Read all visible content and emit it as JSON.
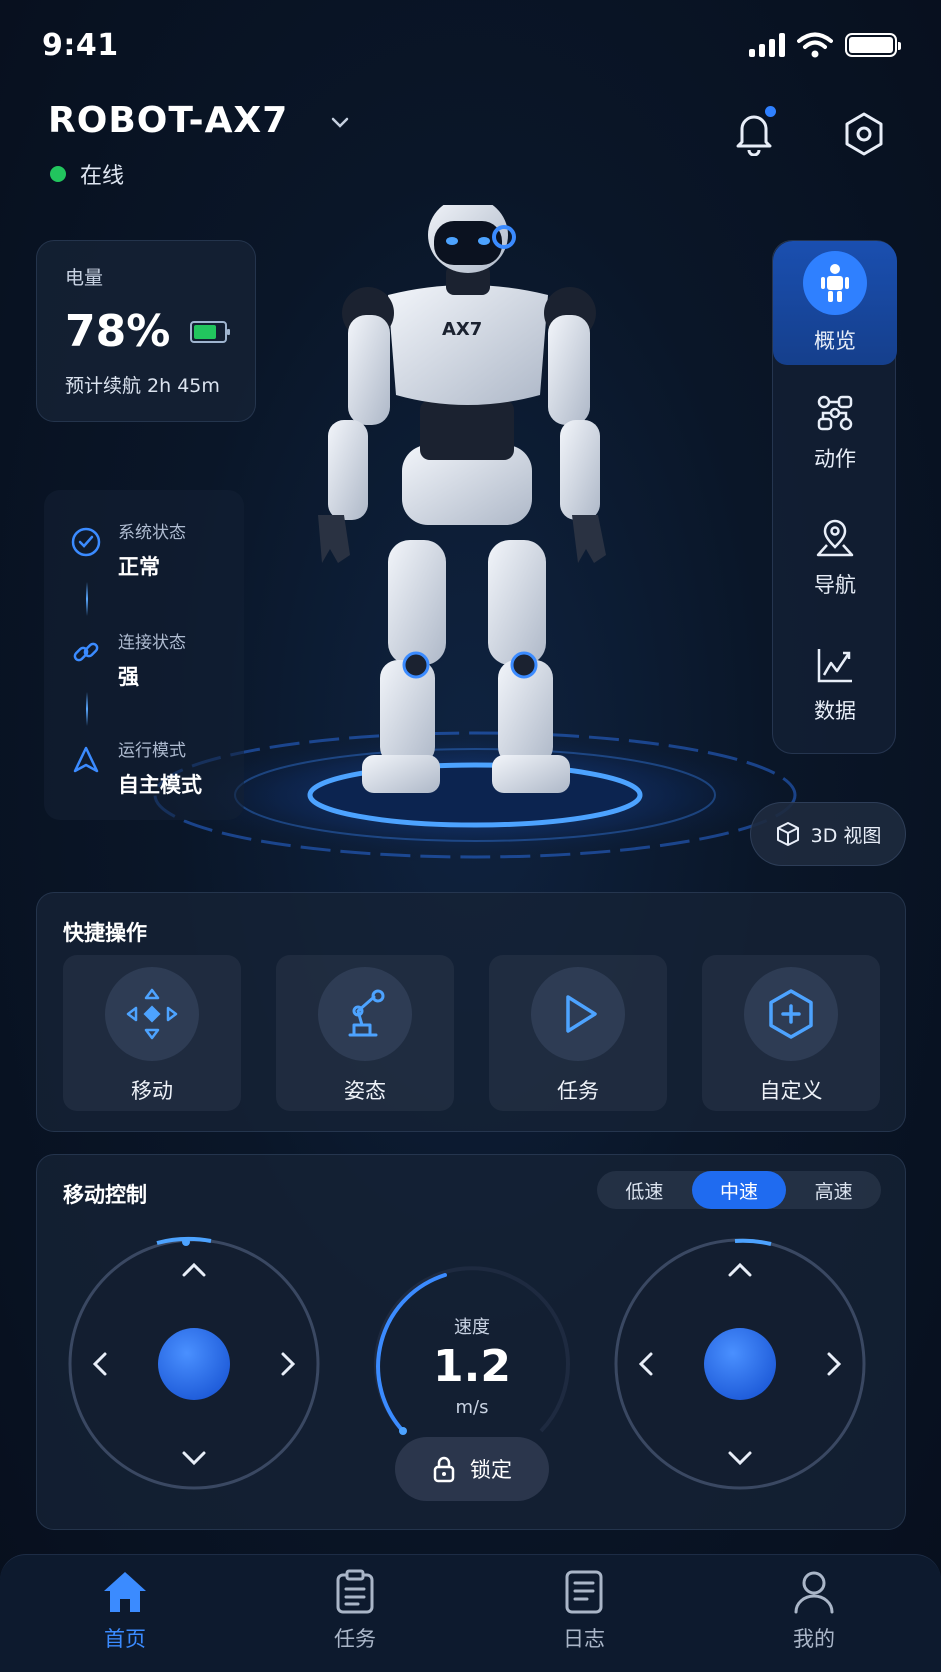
{
  "status_bar": {
    "time": "9:41"
  },
  "header": {
    "robot_name": "ROBOT-AX7",
    "status_text": "在线"
  },
  "battery": {
    "title": "电量",
    "percent": "78%",
    "level": 0.78,
    "runtime": "预计续航 2h 45m"
  },
  "status_list": [
    {
      "label": "系统状态",
      "value": "正常",
      "icon": "check-circle-icon"
    },
    {
      "label": "连接状态",
      "value": "强",
      "icon": "link-icon"
    },
    {
      "label": "运行模式",
      "value": "自主模式",
      "icon": "navigation-arrow-icon"
    }
  ],
  "robot": {
    "model_tag": "AX7"
  },
  "side_nav": {
    "items": [
      {
        "label": "概览",
        "icon": "robot-person-icon",
        "active": true
      },
      {
        "label": "动作",
        "icon": "nodes-icon",
        "active": false
      },
      {
        "label": "导航",
        "icon": "map-pin-icon",
        "active": false
      },
      {
        "label": "数据",
        "icon": "line-chart-icon",
        "active": false
      }
    ]
  },
  "view_3d_label": "3D 视图",
  "quick_actions": {
    "title": "快捷操作",
    "items": [
      {
        "label": "移动",
        "icon": "move-arrows-icon"
      },
      {
        "label": "姿态",
        "icon": "robot-arm-icon"
      },
      {
        "label": "任务",
        "icon": "play-icon"
      },
      {
        "label": "自定义",
        "icon": "hexagon-plus-icon"
      }
    ]
  },
  "movement": {
    "title": "移动控制",
    "speed_modes": [
      "低速",
      "中速",
      "高速"
    ],
    "active_mode": "中速",
    "speed_label": "速度",
    "speed_value": "1.2",
    "speed_unit": "m/s",
    "lock_label": "锁定"
  },
  "tabbar": {
    "items": [
      {
        "label": "首页",
        "icon": "home-icon",
        "active": true
      },
      {
        "label": "任务",
        "icon": "clipboard-icon",
        "active": false
      },
      {
        "label": "日志",
        "icon": "document-icon",
        "active": false
      },
      {
        "label": "我的",
        "icon": "user-icon",
        "active": false
      }
    ]
  },
  "colors": {
    "accent": "#2f80ff",
    "online": "#22c55e",
    "background": "#0a1628"
  }
}
